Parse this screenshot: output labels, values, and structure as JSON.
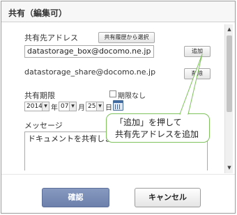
{
  "dialog": {
    "title": "共有（編集可）"
  },
  "form": {
    "recipient_label": "共有先アドレス",
    "history_button": "共有履歴から選択",
    "address_value": "datastorage_box@docomo.ne.jp",
    "add_button": "追加",
    "added_address": "datastorage_share@docomo.ne.jp",
    "delete_button": "削除",
    "period_label": "共有期限",
    "no_limit_label": "期限なし",
    "year": "2014",
    "year_unit": "年",
    "month": "07",
    "month_unit": "月",
    "day": "25",
    "day_unit": "日",
    "message_label": "メッセージ",
    "message_value": "ドキュメントを共有します"
  },
  "callout": {
    "line1": "「追加」を押して",
    "line2": "共有先アドレスを追加",
    "border_color": "#7dc25a"
  },
  "footer": {
    "ok_button": "確認",
    "cancel_button": "キャンセル"
  },
  "icons": {
    "calendar": "calendar-icon",
    "dropdown": "chevron-down-icon"
  }
}
